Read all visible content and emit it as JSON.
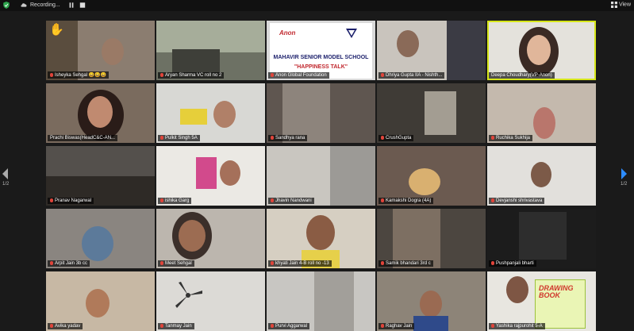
{
  "topbar": {
    "recording_label": "Recording...",
    "view_label": "View"
  },
  "nav": {
    "left_page": "1/2",
    "right_page": "1/2"
  },
  "poster": {
    "school_name": "MAHAVIR SENIOR MODEL SCHOOL",
    "event_title": "\"HAPPINESS TALK\"",
    "brand_logo": "Anon"
  },
  "drawing_book": {
    "title": "DRAWING BOOK"
  },
  "participants": [
    {
      "name": "Isheyka Sehgal 😀😀😀",
      "hand": true
    },
    {
      "name": "Aryan  Sharma VC roll no 2"
    },
    {
      "name": "Anon Global Foundation",
      "is_poster": true
    },
    {
      "name": "Dhriya Gupta IIA - Nishth..."
    },
    {
      "name": "Deepa Choudhary(VP-Anon)",
      "active": true
    },
    {
      "name": "Prachi Biswas(HeadC&C-AN..."
    },
    {
      "name": "Pulkit Singh 5A"
    },
    {
      "name": "Sandhya rana"
    },
    {
      "name": "CrushGupta"
    },
    {
      "name": "Ruchika Sukhija"
    },
    {
      "name": "Pranav Nagarwal"
    },
    {
      "name": "ishika Garg"
    },
    {
      "name": "Jhavin Nandwani"
    },
    {
      "name": "Kamakshi Dogra (4A)"
    },
    {
      "name": "Devjanshi shrivastava"
    },
    {
      "name": "Arpit Jain 3b  cc"
    },
    {
      "name": "Meet Sehgal"
    },
    {
      "name": "khyati Jain 4-B roll no -13"
    },
    {
      "name": "Samik bhandari 3rd c"
    },
    {
      "name": "Pushpanjali bharti"
    },
    {
      "name": "Avika yadav"
    },
    {
      "name": "Tanmay Jain"
    },
    {
      "name": "Purvi Aggarwal"
    },
    {
      "name": "Raghav Jain"
    },
    {
      "name": "Yashika rajpurohit 5-A",
      "has_book": true
    }
  ]
}
